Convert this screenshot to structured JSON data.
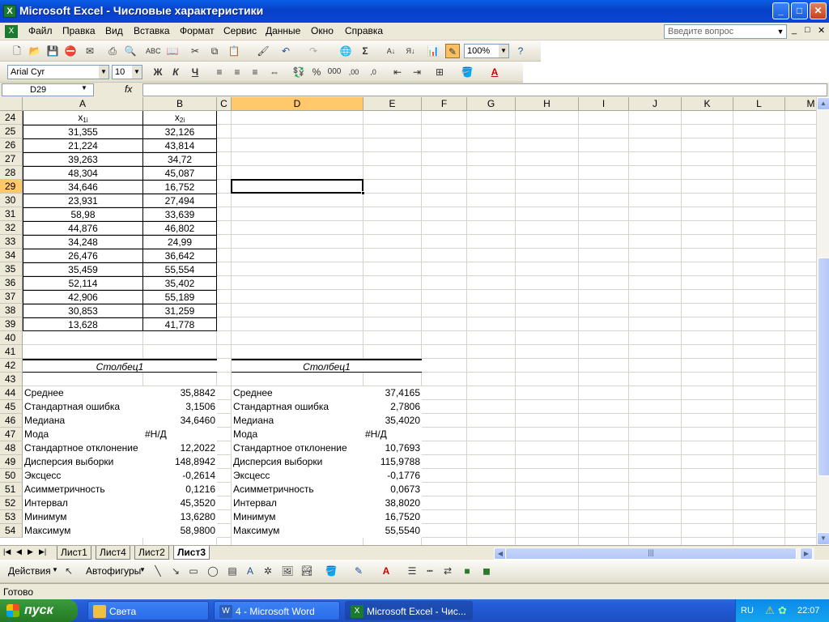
{
  "window": {
    "title": "Microsoft Excel - Числовые характеристики",
    "btn_min": "_",
    "btn_max": "□",
    "btn_close": "✕"
  },
  "menu": {
    "items": [
      "Файл",
      "Правка",
      "Вид",
      "Вставка",
      "Формат",
      "Сервис",
      "Данные",
      "Окно",
      "Справка"
    ],
    "ask_placeholder": "Введите вопрос",
    "doc_controls": [
      "_",
      "□",
      "✕"
    ]
  },
  "toolbar": {
    "zoom": "100%",
    "font_name": "Arial Cyr",
    "font_size": "10",
    "bold": "Ж",
    "italic": "К",
    "underline": "Ч",
    "percent": "%",
    "thousands": "000",
    "inc_decimal": ",00",
    "dec_decimal": ",0"
  },
  "formula": {
    "name_box": "D29",
    "fx": "fx",
    "value": ""
  },
  "columns": [
    "A",
    "B",
    "C",
    "D",
    "E",
    "F",
    "G",
    "H",
    "I",
    "J",
    "K",
    "L",
    "M"
  ],
  "selected_column": "D",
  "rows": [
    "24",
    "25",
    "26",
    "27",
    "28",
    "29",
    "30",
    "31",
    "32",
    "33",
    "34",
    "35",
    "36",
    "37",
    "38",
    "39",
    "40",
    "41",
    "42",
    "43",
    "44",
    "45",
    "46",
    "47",
    "48",
    "49",
    "50",
    "51",
    "52",
    "53",
    "54"
  ],
  "selected_row": "29",
  "headers": {
    "x1": "x",
    "x1_sub": "1i",
    "x2": "x",
    "x2_sub": "2i"
  },
  "data_x1": [
    "31,355",
    "21,224",
    "39,263",
    "48,304",
    "34,646",
    "23,931",
    "58,98",
    "44,876",
    "34,248",
    "26,476",
    "35,459",
    "52,114",
    "42,906",
    "30,853",
    "13,628"
  ],
  "data_x2": [
    "32,126",
    "43,814",
    "34,72",
    "45,087",
    "16,752",
    "27,494",
    "33,639",
    "46,802",
    "24,99",
    "36,642",
    "55,554",
    "35,402",
    "55,189",
    "31,259",
    "41,778"
  ],
  "stats1": {
    "title": "Столбец1",
    "labels": [
      "Среднее",
      "Стандартная ошибка",
      "Медиана",
      "Мода",
      "Стандартное отклонение",
      "Дисперсия выборки",
      "Эксцесс",
      "Асимметричность",
      "Интервал",
      "Минимум",
      "Максимум"
    ],
    "values": [
      "35,8842",
      "3,1506",
      "34,6460",
      "#Н/Д",
      "12,2022",
      "148,8942",
      "-0,2614",
      "0,1216",
      "45,3520",
      "13,6280",
      "58,9800"
    ]
  },
  "stats2": {
    "title": "Столбец1",
    "labels": [
      "Среднее",
      "Стандартная ошибка",
      "Медиана",
      "Мода",
      "Стандартное отклонение",
      "Дисперсия выборки",
      "Эксцесс",
      "Асимметричность",
      "Интервал",
      "Минимум",
      "Максимум"
    ],
    "values": [
      "37,4165",
      "2,7806",
      "35,4020",
      "#Н/Д",
      "10,7693",
      "115,9788",
      "-0,1776",
      "0,0673",
      "38,8020",
      "16,7520",
      "55,5540"
    ]
  },
  "sheets": [
    "Лист1",
    "Лист4",
    "Лист2",
    "Лист3"
  ],
  "active_sheet": "Лист3",
  "draw_toolbar": {
    "actions": "Действия",
    "autoshapes": "Автофигуры"
  },
  "status": "Готово",
  "taskbar": {
    "start": "пуск",
    "tasks": [
      "Света",
      "4 - Microsoft Word",
      "Microsoft Excel - Чис..."
    ],
    "lang": "RU",
    "time": "22:07"
  }
}
